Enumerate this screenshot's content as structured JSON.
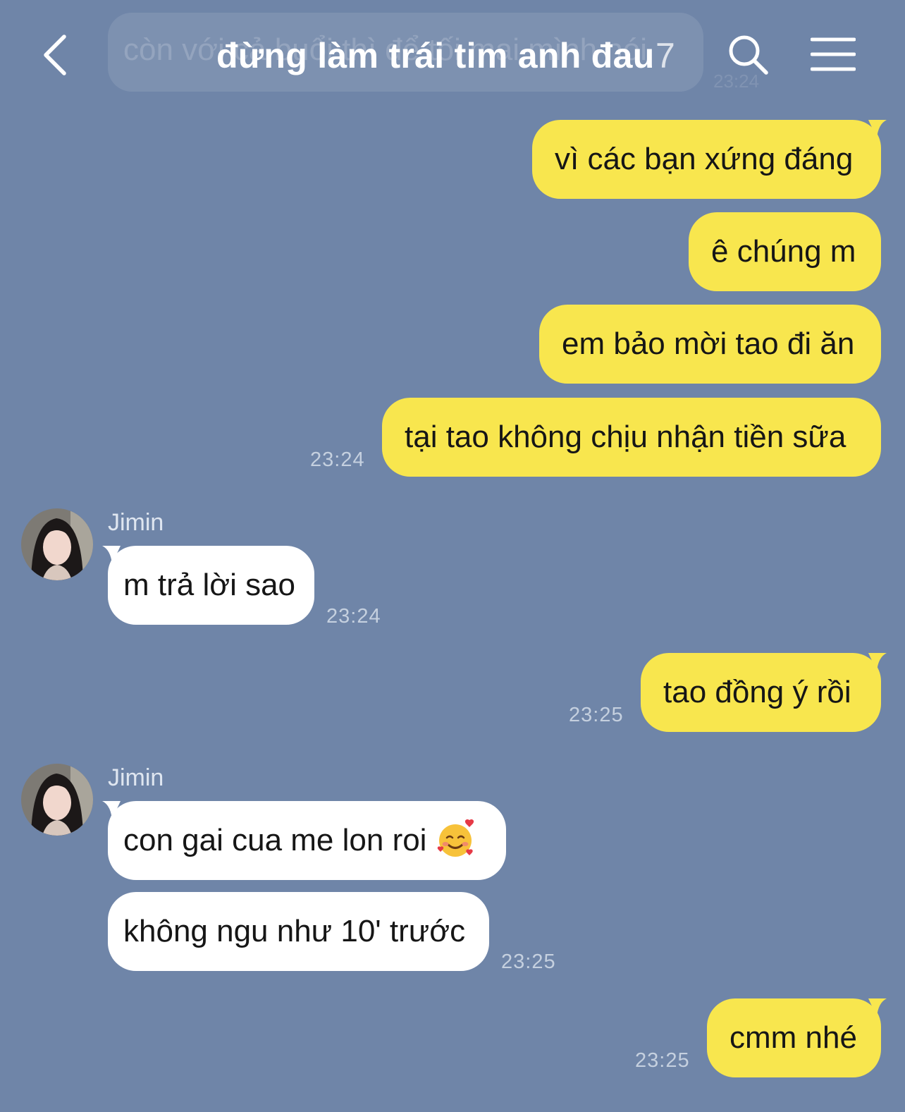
{
  "header": {
    "title": "đừng làm trái tim anh đau",
    "member_count": "7",
    "ghost_preview": "còn với cả buổi thì để tối mai mình nói",
    "ghost_time": "23:24"
  },
  "messages": [
    {
      "direction": "out",
      "text": "vì các bạn xứng đáng"
    },
    {
      "direction": "out",
      "text": "ê chúng m"
    },
    {
      "direction": "out",
      "text": "em bảo mời tao đi ăn"
    },
    {
      "direction": "out",
      "text": "tại tao không chịu nhận tiền sữa",
      "time": "23:24"
    },
    {
      "direction": "in",
      "sender": "Jimin",
      "text": "m trả lời sao",
      "time": "23:24"
    },
    {
      "direction": "out",
      "text": "tao đồng ý rồi",
      "time": "23:25"
    },
    {
      "direction": "in",
      "sender": "Jimin",
      "text": "con gai cua me lon roi",
      "emoji": "smiling-face-with-hearts"
    },
    {
      "direction": "in",
      "text": "không ngu như 10' trước",
      "time": "23:25"
    },
    {
      "direction": "out",
      "text": "cmm nhé",
      "time": "23:25"
    }
  ],
  "colors": {
    "background": "#6f85a8",
    "outgoing_bubble": "#f8e64e",
    "incoming_bubble": "#ffffff",
    "timestamp": "#c5d0df"
  }
}
